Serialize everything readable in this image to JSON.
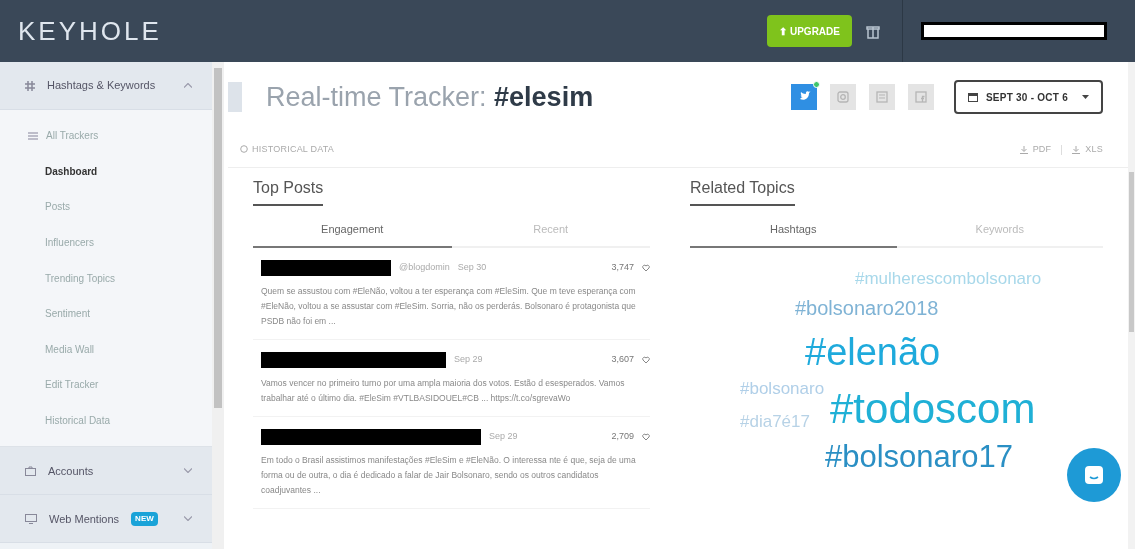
{
  "header": {
    "logo": "KEYHOLE",
    "upgrade_button": "⬆ UPGRADE"
  },
  "sidebar": {
    "items": [
      {
        "label": "Hashtags & Keywords",
        "expanded": true,
        "children": [
          {
            "label": "All Trackers",
            "selected": false
          },
          {
            "label": "Dashboard",
            "selected": true
          },
          {
            "label": "Posts",
            "selected": false
          },
          {
            "label": "Influencers",
            "selected": false
          },
          {
            "label": "Trending Topics",
            "selected": false
          },
          {
            "label": "Sentiment",
            "selected": false
          },
          {
            "label": "Media Wall",
            "selected": false
          },
          {
            "label": "Edit Tracker",
            "selected": false
          },
          {
            "label": "Historical Data",
            "selected": false
          }
        ]
      },
      {
        "label": "Accounts",
        "expanded": false
      },
      {
        "label": "Web Mentions",
        "expanded": false,
        "badge": "NEW"
      }
    ]
  },
  "page": {
    "title_prefix": "Real-time Tracker:",
    "title_tag": "#elesim",
    "networks": [
      {
        "kind": "twitter",
        "selected": true
      },
      {
        "kind": "instagram",
        "selected": false
      },
      {
        "kind": "news",
        "selected": false
      },
      {
        "kind": "facebook",
        "selected": false
      }
    ],
    "date_range": "SEPT 30 - OCT 6",
    "historical_link": "HISTORICAL DATA",
    "exports": [
      "PDF",
      "XLS"
    ]
  },
  "top_posts": {
    "title": "Top Posts",
    "tabs": [
      {
        "label": "Engagement",
        "selected": true
      },
      {
        "label": "Recent",
        "selected": false
      }
    ],
    "posts": [
      {
        "handle": "@blogdomin",
        "date": "Sep 30",
        "engagement": "3,747",
        "text": "Quem se assustou com #EleNão, voltou a ter esperança com #EleSim. Que m teve esperança com #EleNão, voltou a se assustar com #EleSim. Sorria, não os perderás. Bolsonaro é protagonista que PSDB não foi em ..."
      },
      {
        "date": "Sep 29",
        "engagement": "3,607",
        "text": "Vamos vencer no primeiro turno por uma ampla maioria dos votos. Estão d esesperados. Vamos trabalhar até o último dia. #EleSim #VTLBASIDOUEL#CB ... https://t.co/sgrevaWo"
      },
      {
        "date": "Sep 29",
        "engagement": "2,709",
        "text": "Em todo o Brasil assistimos manifestações #EleSim e #EleNão. O interessa nte é que, seja de uma forma ou de outra, o dia é dedicado a falar de Jair Bolsonaro, sendo os outros candidatos coadjuvantes ..."
      }
    ]
  },
  "related_topics": {
    "title": "Related Topics",
    "tabs": [
      {
        "label": "Hashtags",
        "selected": true
      },
      {
        "label": "Keywords",
        "selected": false
      }
    ],
    "cloud": [
      {
        "text": "#mulherescombolsonaro",
        "color": "#a8d8ea"
      },
      {
        "text": "#bolsonaro2018",
        "color": "#7fb3d5"
      },
      {
        "text": "#elenão",
        "color": "#1eaadc"
      },
      {
        "text": "#bolsonaro",
        "color": "#b0cfe8"
      },
      {
        "text": "#dia7é17",
        "color": "#b7d2e6"
      },
      {
        "text": "#todoscom",
        "color": "#1fb0d6"
      },
      {
        "text": "#bolsonaro17",
        "color": "#2a8fc4"
      }
    ]
  }
}
